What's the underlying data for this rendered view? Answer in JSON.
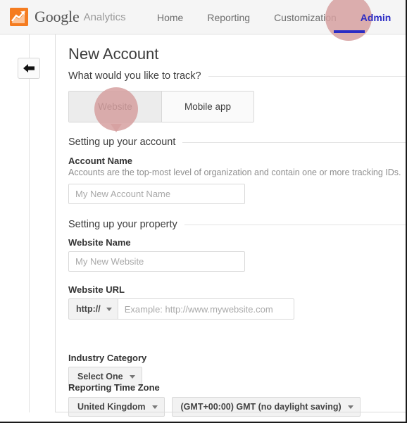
{
  "header": {
    "logo_google": "Google",
    "logo_analytics": "Analytics",
    "logo_icon": "google-analytics-logo-icon",
    "nav": [
      {
        "label": "Home",
        "active": false
      },
      {
        "label": "Reporting",
        "active": false
      },
      {
        "label": "Customization",
        "active": false
      },
      {
        "label": "Admin",
        "active": true
      }
    ]
  },
  "sidebar": {
    "collapse_icon": "arrow-left-icon"
  },
  "main": {
    "page_title": "New Account",
    "track_section": {
      "heading": "What would you like to track?",
      "options": [
        {
          "label": "Website",
          "selected": true
        },
        {
          "label": "Mobile app",
          "selected": false
        }
      ]
    },
    "account_section": {
      "heading": "Setting up your account",
      "account_name_label": "Account Name",
      "account_name_help": "Accounts are the top-most level of organization and contain one or more tracking IDs.",
      "account_name_value": "",
      "account_name_placeholder": "My New Account Name"
    },
    "property_section": {
      "heading": "Setting up your property",
      "website_name_label": "Website Name",
      "website_name_value": "",
      "website_name_placeholder": "My New Website",
      "website_url_label": "Website URL",
      "website_url_protocol": "http://",
      "website_url_value": "",
      "website_url_placeholder": "Example: http://www.mywebsite.com",
      "industry_label": "Industry Category",
      "industry_value": "Select One",
      "timezone_label": "Reporting Time Zone",
      "timezone_country": "United Kingdom",
      "timezone_offset": "(GMT+00:00) GMT (no daylight saving)"
    }
  },
  "highlights": {
    "color": "#d6a0a0",
    "targets": [
      "Admin",
      "Website"
    ]
  },
  "colors": {
    "accent_blue": "#2b2bc4",
    "logo_orange": "#f57c20",
    "header_bg": "#f5f5f5"
  }
}
